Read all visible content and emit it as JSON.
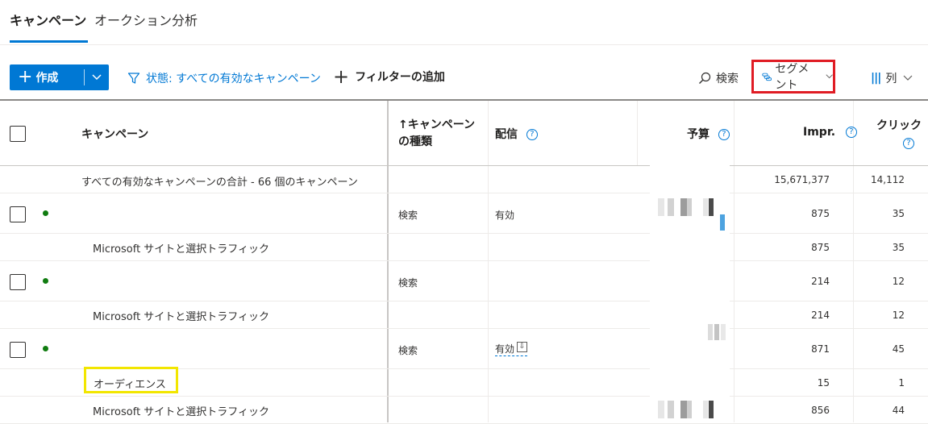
{
  "tabs": {
    "campaigns": "キャンペーン",
    "auction": "オークション分析"
  },
  "toolbar": {
    "create_label": "作成",
    "filter_status": "状態: すべての有効なキャンペーン",
    "add_filter": "フィルターの追加",
    "search": "検索",
    "segment": "セグメント",
    "columns": "列"
  },
  "table": {
    "headers": {
      "campaign": "キャンペーン",
      "campaign_type_line1": "↑キャンペーン",
      "campaign_type_line2": "の種類",
      "delivery": "配信",
      "budget": "予算",
      "impr": "Impr.",
      "clicks": "クリック"
    },
    "total": {
      "label": "すべての有効なキャンペーンの合計 - 66 個のキャンペーン",
      "impr": "15,671,377",
      "clicks": "14,112"
    },
    "rows": [
      {
        "type": "検索",
        "delivery": "有効",
        "impr": "875",
        "clicks": "35"
      },
      {
        "label": "Microsoft サイトと選択トラフィック",
        "impr": "875",
        "clicks": "35"
      },
      {
        "type": "検索",
        "impr": "214",
        "clicks": "12"
      },
      {
        "label": "Microsoft サイトと選択トラフィック",
        "impr": "214",
        "clicks": "12"
      },
      {
        "type": "検索",
        "delivery": "有効",
        "impr": "871",
        "clicks": "45"
      },
      {
        "label": "オーディエンス",
        "impr": "15",
        "clicks": "1"
      },
      {
        "label": "Microsoft サイトと選択トラフィック",
        "impr": "856",
        "clicks": "44"
      }
    ]
  },
  "colors": {
    "accent": "#0078d4",
    "highlight_red": "#e01c24",
    "highlight_yellow": "#f2e600",
    "status_green": "#107c10"
  }
}
